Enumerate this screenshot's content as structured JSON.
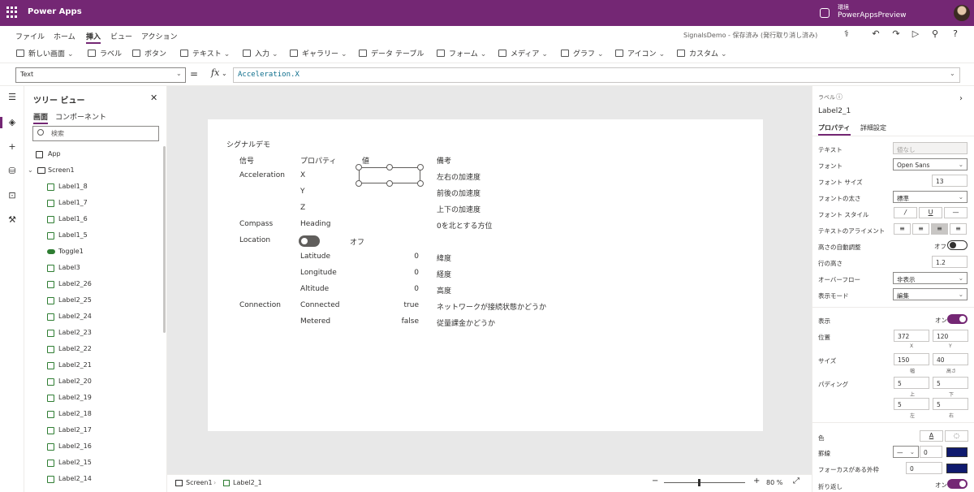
{
  "app": {
    "name": "Power Apps"
  },
  "env": {
    "label": "環境",
    "name": "PowerAppsPreview"
  },
  "menu": {
    "tabs": [
      "ファイル",
      "ホーム",
      "挿入",
      "ビュー",
      "アクション"
    ],
    "active": "挿入",
    "doc_status": "SignalsDemo - 保存済み (発行取り消し済み)"
  },
  "ribbon": {
    "new_screen": "新しい画面",
    "label": "ラベル",
    "button": "ボタン",
    "text": "テキスト",
    "input": "入力",
    "gallery": "ギャラリー",
    "data_table": "データ テーブル",
    "form": "フォーム",
    "media": "メディア",
    "chart": "グラフ",
    "icons": "アイコン",
    "custom": "カスタム"
  },
  "formula": {
    "property": "Text",
    "expression": "Acceleration.X"
  },
  "tree": {
    "title": "ツリー ビュー",
    "tabs": [
      "画面",
      "コンポーネント"
    ],
    "search_placeholder": "検索",
    "app_label": "App",
    "screen_label": "Screen1",
    "items": [
      {
        "name": "Label1_8",
        "icon": "label"
      },
      {
        "name": "Label1_7",
        "icon": "label"
      },
      {
        "name": "Label1_6",
        "icon": "label"
      },
      {
        "name": "Label1_5",
        "icon": "label"
      },
      {
        "name": "Toggle1",
        "icon": "toggle"
      },
      {
        "name": "Label3",
        "icon": "label"
      },
      {
        "name": "Label2_26",
        "icon": "label"
      },
      {
        "name": "Label2_25",
        "icon": "label"
      },
      {
        "name": "Label2_24",
        "icon": "label"
      },
      {
        "name": "Label2_23",
        "icon": "label"
      },
      {
        "name": "Label2_22",
        "icon": "label"
      },
      {
        "name": "Label2_21",
        "icon": "label"
      },
      {
        "name": "Label2_20",
        "icon": "label"
      },
      {
        "name": "Label2_19",
        "icon": "label"
      },
      {
        "name": "Label2_18",
        "icon": "label"
      },
      {
        "name": "Label2_17",
        "icon": "label"
      },
      {
        "name": "Label2_16",
        "icon": "label"
      },
      {
        "name": "Label2_15",
        "icon": "label"
      },
      {
        "name": "Label2_14",
        "icon": "label"
      }
    ]
  },
  "canvas": {
    "title": "シグナルデモ",
    "headers": {
      "signal": "信号",
      "property": "プロパティ",
      "value": "値",
      "note": "備考"
    },
    "accel": {
      "signal": "Acceleration",
      "x": "X",
      "y": "Y",
      "z": "Z",
      "x_note": "左右の加速度",
      "y_note": "前後の加速度",
      "z_note": "上下の加速度"
    },
    "compass": {
      "signal": "Compass",
      "prop": "Heading",
      "note": "0を北とする方位"
    },
    "location": {
      "signal": "Location",
      "toggle_text": "オフ",
      "lat": "Latitude",
      "lat_val": "0",
      "lat_note": "緯度",
      "lon": "Longitude",
      "lon_val": "0",
      "lon_note": "経度",
      "alt": "Altitude",
      "alt_val": "0",
      "alt_note": "高度"
    },
    "connection": {
      "signal": "Connection",
      "connected": "Connected",
      "connected_val": "true",
      "connected_note": "ネットワークが接続状態かどうか",
      "metered": "Metered",
      "metered_val": "false",
      "metered_note": "従量課金かどうか"
    }
  },
  "statusbar": {
    "screen": "Screen1",
    "control": "Label2_1",
    "zoom": "80 %",
    "minus": "−",
    "plus": "+"
  },
  "props": {
    "type": "ラベル",
    "name": "Label2_1",
    "tabs": [
      "プロパティ",
      "詳細設定"
    ],
    "text_label": "テキスト",
    "text_value": "値なし",
    "font_label": "フォント",
    "font_value": "Open Sans",
    "font_size_label": "フォント サイズ",
    "font_size_value": "13",
    "font_weight_label": "フォントの太さ",
    "font_weight_value": "標準",
    "font_style_label": "フォント スタイル",
    "align_label": "テキストのアライメント",
    "autoheight_label": "高さの自動調整",
    "autoheight_value": "オフ",
    "line_height_label": "行の高さ",
    "line_height_value": "1.2",
    "overflow_label": "オーバーフロー",
    "overflow_value": "非表示",
    "display_mode_label": "表示モード",
    "display_mode_value": "編集",
    "visible_label": "表示",
    "visible_value": "オン",
    "position_label": "位置",
    "pos_x": "372",
    "pos_y": "120",
    "cap_x": "X",
    "cap_y": "Y",
    "size_label": "サイズ",
    "width": "150",
    "height": "40",
    "cap_w": "幅",
    "cap_h": "高さ",
    "padding_label": "パディング",
    "pad_top": "5",
    "pad_bottom": "5",
    "pad_left": "5",
    "pad_right": "5",
    "cap_top": "上",
    "cap_bottom": "下",
    "cap_left": "左",
    "cap_right": "右",
    "color_label": "色",
    "color_text_glyph": "A",
    "border_label": "罫線",
    "border_width": "0",
    "border_color": "#0f1a6e",
    "focus_border_label": "フォーカスがある外枠",
    "focus_border_width": "0",
    "focus_border_color": "#0f1a6e",
    "wrap_label": "折り返し",
    "wrap_value": "オン"
  },
  "colors": {
    "brand": "#742774",
    "selection_toggle": "#742774"
  }
}
